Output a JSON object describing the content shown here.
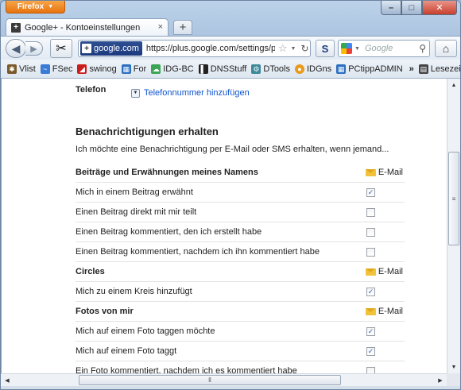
{
  "browser": {
    "menu_button": "Firefox",
    "window_controls": {
      "minimize": "–",
      "maximize": "□",
      "close": "✕"
    },
    "tab": {
      "title": "Google+ - Kontoeinstellungen",
      "close": "×"
    },
    "new_tab": "+",
    "site_identity": "google.com",
    "url": "https://plus.google.com/settings/pl",
    "search_placeholder": "Google",
    "bookmarks": [
      {
        "label": "Vlist",
        "icon": "hedgehog-icon",
        "color": "#7a5a2a"
      },
      {
        "label": "FSec",
        "icon": "fish-icon",
        "color": "#3a7bd5"
      },
      {
        "label": "swinog",
        "icon": "swinog-icon",
        "color": "#cc1d1d"
      },
      {
        "label": "For",
        "icon": "grid-icon",
        "color": "#2a6fbf"
      },
      {
        "label": "IDG-BC",
        "icon": "cloud-icon",
        "color": "#3aa655"
      },
      {
        "label": "DNSStuff",
        "icon": "dnsstuff-icon",
        "color": "#222222"
      },
      {
        "label": "DTools",
        "icon": "tools-icon",
        "color": "#3c8a9c"
      },
      {
        "label": "IDGns",
        "icon": "idgns-icon",
        "color": "#e89a1c"
      },
      {
        "label": "PCtippADMIN",
        "icon": "grid-icon",
        "color": "#2a6fbf"
      }
    ],
    "bookmarks_more": "»",
    "bookmarks_menu": "Lesezeichen"
  },
  "page": {
    "phone_label": "Telefon",
    "phone_link": "Telefonnummer hinzufügen",
    "notifications_heading": "Benachrichtigungen erhalten",
    "notifications_intro": "Ich möchte eine Benachrichtigung per E-Mail oder SMS erhalten, wenn jemand...",
    "email_column": "E-Mail",
    "sections": [
      {
        "title": "Beiträge und Erwähnungen meines Namens",
        "items": [
          {
            "label": "Mich in einem Beitrag erwähnt",
            "email": true
          },
          {
            "label": "Einen Beitrag direkt mit mir teilt",
            "email": false
          },
          {
            "label": "Einen Beitrag kommentiert, den ich erstellt habe",
            "email": false
          },
          {
            "label": "Einen Beitrag kommentiert, nachdem ich ihn kommentiert habe",
            "email": false
          }
        ]
      },
      {
        "title": "Circles",
        "items": [
          {
            "label": "Mich zu einem Kreis hinzufügt",
            "email": true
          }
        ]
      },
      {
        "title": "Fotos von mir",
        "items": [
          {
            "label": "Mich auf einem Foto taggen möchte",
            "email": true
          },
          {
            "label": "Mich auf einem Foto taggt",
            "email": true
          },
          {
            "label": "Ein Foto kommentiert, nachdem ich es kommentiert habe",
            "email": false
          }
        ]
      }
    ]
  }
}
